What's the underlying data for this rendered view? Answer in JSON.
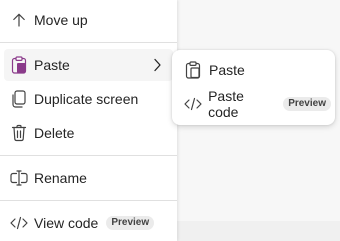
{
  "menu": {
    "items": [
      {
        "label": "Move up",
        "icon": "arrow-up-icon"
      },
      {
        "label": "Paste",
        "icon": "clipboard-icon",
        "icon_color": "#8a3a8a",
        "has_submenu": true
      },
      {
        "label": "Duplicate screen",
        "icon": "copy-icon"
      },
      {
        "label": "Delete",
        "icon": "trash-icon"
      },
      {
        "label": "Rename",
        "icon": "rename-icon"
      },
      {
        "label": "View code",
        "icon": "code-icon",
        "badge": "Preview"
      }
    ]
  },
  "submenu": {
    "items": [
      {
        "label": "Paste",
        "icon": "clipboard-icon"
      },
      {
        "label": "Paste code",
        "icon": "code-icon",
        "badge": "Preview"
      }
    ]
  },
  "colors": {
    "accent": "#8a3a8a",
    "hover_bg": "#f5f5f5",
    "separator": "#e0e0e0",
    "badge_bg": "#ebebeb"
  }
}
